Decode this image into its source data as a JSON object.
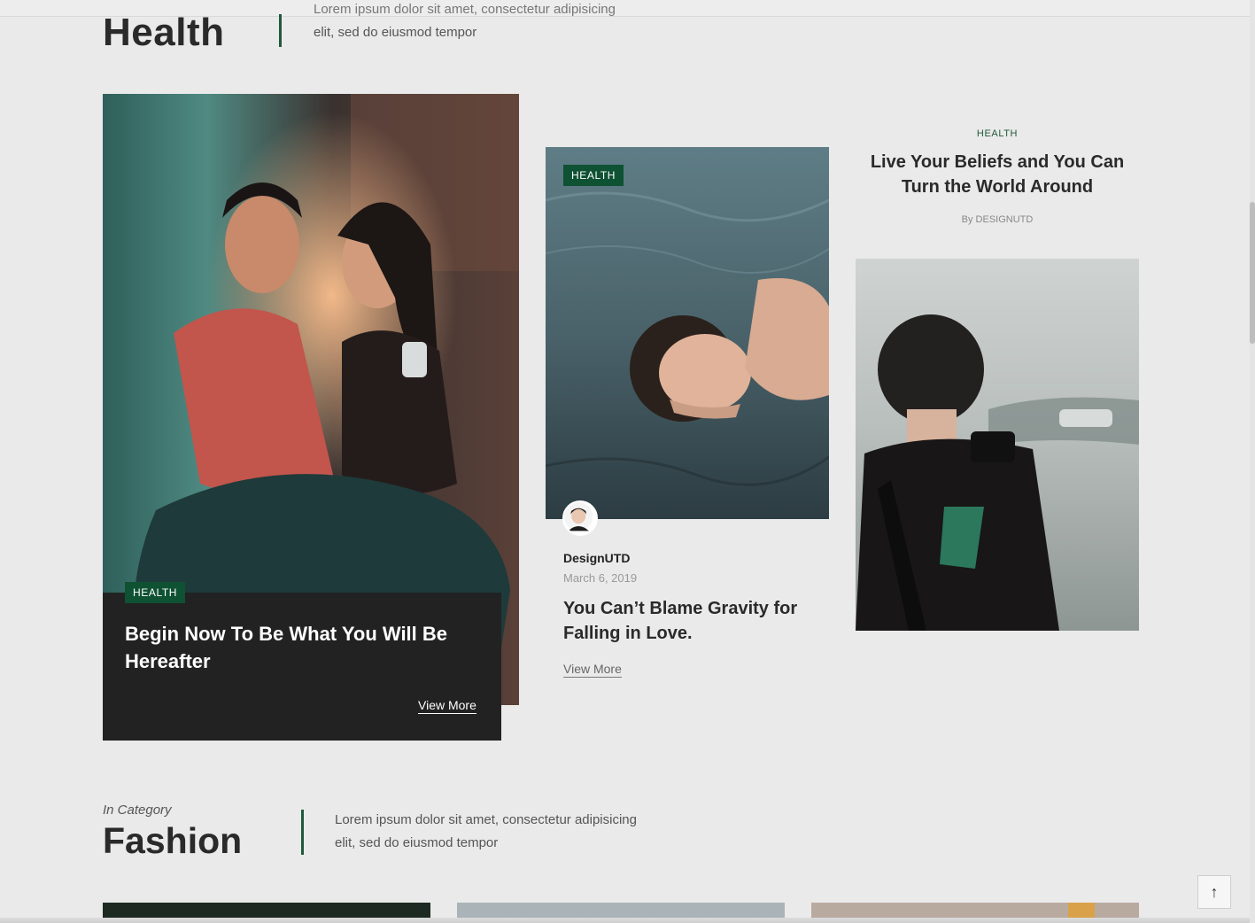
{
  "health_section": {
    "title": "Health",
    "intro_clipped": "Lorem ipsum dolor sit amet, consectetur adipisicing",
    "intro_line2": "elit, sed do eiusmod tempor"
  },
  "cards": [
    {
      "category": "HEALTH",
      "title": "Begin Now To Be What You Will Be Hereafter",
      "more": "View More",
      "image": "couple-photo"
    },
    {
      "category": "HEALTH",
      "author": "DesignUTD",
      "date": "March 6, 2019",
      "title": "You Can’t Blame Gravity for Falling in Love.",
      "more": "View More",
      "image": "woman-in-water-photo"
    },
    {
      "category": "HEALTH",
      "title": "Live Your Beliefs and You Can Turn the World Around",
      "byline": "By DESIGNUTD",
      "image": "photographer-photo"
    }
  ],
  "fashion_section": {
    "kicker": "In Category",
    "title": "Fashion",
    "intro_line1": "Lorem ipsum dolor sit amet, consectetur adipisicing",
    "intro_line2": "elit, sed do eiusmod tempor"
  },
  "back_to_top": "↑",
  "colors": {
    "accent": "#0f5133",
    "background": "#eaeaea",
    "dark_card": "#222222"
  }
}
